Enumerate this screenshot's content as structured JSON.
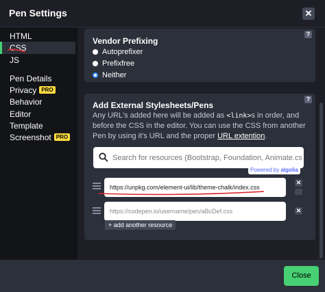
{
  "header": {
    "title": "Pen Settings",
    "close_glyph": "✕"
  },
  "sidebar": {
    "items": [
      {
        "label": "HTML"
      },
      {
        "label": "CSS",
        "active": true
      },
      {
        "label": "JS"
      },
      {
        "label": "Pen Details"
      },
      {
        "label": "Privacy",
        "badge": "PRO"
      },
      {
        "label": "Behavior"
      },
      {
        "label": "Editor"
      },
      {
        "label": "Template"
      },
      {
        "label": "Screenshot",
        "badge": "PRO"
      }
    ]
  },
  "vendor": {
    "title": "Vendor Prefixing",
    "help": "?",
    "options": [
      {
        "label": "Autoprefixer",
        "checked": false
      },
      {
        "label": "Prefixfree",
        "checked": false
      },
      {
        "label": "Neither",
        "checked": true
      }
    ]
  },
  "external": {
    "title": "Add External Stylesheets/Pens",
    "help": "?",
    "desc_part1": "Any URL's added here will be added as ",
    "desc_code": "<link>",
    "desc_part2": "s in order, and before the CSS in the editor. You can use the CSS from another Pen by using it's URL and the proper ",
    "desc_link": "URL extention",
    "desc_end": ".",
    "search_placeholder": "Search for resources (Bootstrap, Foundation, Animate.css...)",
    "powered_by": "Powered by ",
    "powered_brand": "algolia",
    "resources": [
      {
        "value": "https://unpkg.com/element-ui/lib/theme-chalk/index.css",
        "placeholder": ""
      },
      {
        "value": "",
        "placeholder": "https://codepen.io/username/pen/aBcDef.css"
      }
    ],
    "add_label": "+ add another resource",
    "remove_glyph": "✕"
  },
  "footer": {
    "close_label": "Close"
  },
  "colors": {
    "accent_green": "#47cf73",
    "pro_yellow": "#ffdd40",
    "annotation_red": "#d8262b",
    "radio_blue": "#2f8cff"
  }
}
